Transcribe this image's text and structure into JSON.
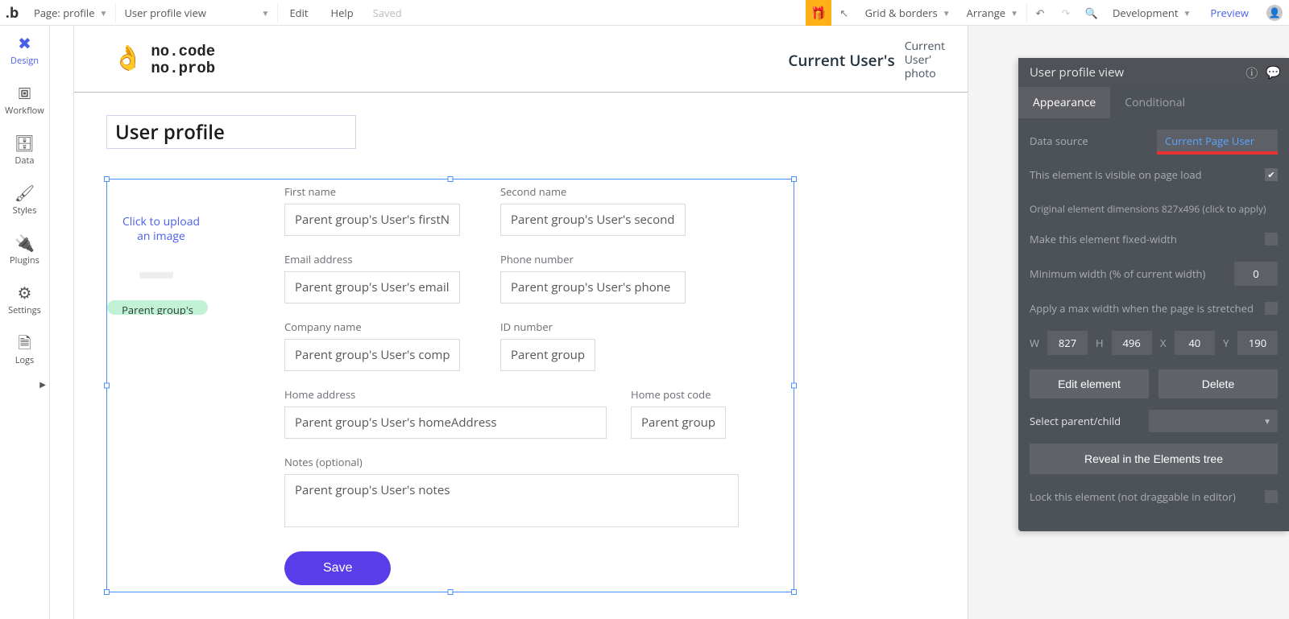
{
  "toolbar": {
    "page_dropdown": "Page: profile",
    "element_dropdown": "User profile view",
    "edit": "Edit",
    "help": "Help",
    "saved": "Saved",
    "grid_borders": "Grid & borders",
    "arrange": "Arrange",
    "environment": "Development",
    "preview": "Preview"
  },
  "sidebar": {
    "items": [
      {
        "label": "Design",
        "icon": "✖"
      },
      {
        "label": "Workflow",
        "icon": "⛬"
      },
      {
        "label": "Data",
        "icon": "≡"
      },
      {
        "label": "Styles",
        "icon": "✎"
      },
      {
        "label": "Plugins",
        "icon": "⎘"
      },
      {
        "label": "Settings",
        "icon": "⚙"
      },
      {
        "label": "Logs",
        "icon": "🗎"
      }
    ]
  },
  "page_header": {
    "brand_line1": "no.code",
    "brand_line2": "no.prob",
    "current_user": "Current User's",
    "photo_label": "Current\nUser'\nphoto"
  },
  "title": "User profile",
  "upload": {
    "text": "Click to upload an image",
    "parent_text": "Parent group's User's"
  },
  "fields": {
    "first_name_label": "First name",
    "first_name_value": "Parent group's User's firstName",
    "second_name_label": "Second name",
    "second_name_value": "Parent group's User's secondName",
    "email_label": "Email address",
    "email_value": "Parent group's User's email",
    "phone_label": "Phone number",
    "phone_value": "Parent group's User's phone",
    "company_label": "Company name",
    "company_value": "Parent group's User's companyNa",
    "id_label": "ID number",
    "id_value": "Parent group's Us",
    "home_addr_label": "Home address",
    "home_addr_value": "Parent group's User's homeAddress",
    "home_post_label": "Home post code",
    "home_post_value": "Parent group's Us",
    "notes_label": "Notes (optional)",
    "notes_value": "Parent group's User's notes",
    "save": "Save"
  },
  "panel": {
    "title": "User profile view",
    "tabs": {
      "appearance": "Appearance",
      "conditional": "Conditional"
    },
    "data_source_label": "Data source",
    "data_source_value": "Current Page User",
    "visible_label": "This element is visible on page load",
    "dimensions_text": "Original element dimensions 827x496 (click to apply)",
    "fixed_width_label": "Make this element fixed-width",
    "min_width_label": "Minimum width (% of current width)",
    "min_width_value": "0",
    "max_width_label": "Apply a max width when the page is stretched",
    "w_label": "W",
    "w": "827",
    "h_label": "H",
    "h": "496",
    "x_label": "X",
    "x": "40",
    "y_label": "Y",
    "y": "190",
    "edit_element": "Edit element",
    "delete": "Delete",
    "select_parent_label": "Select parent/child",
    "reveal": "Reveal in the Elements tree",
    "lock_label": "Lock this element (not draggable in editor)"
  }
}
